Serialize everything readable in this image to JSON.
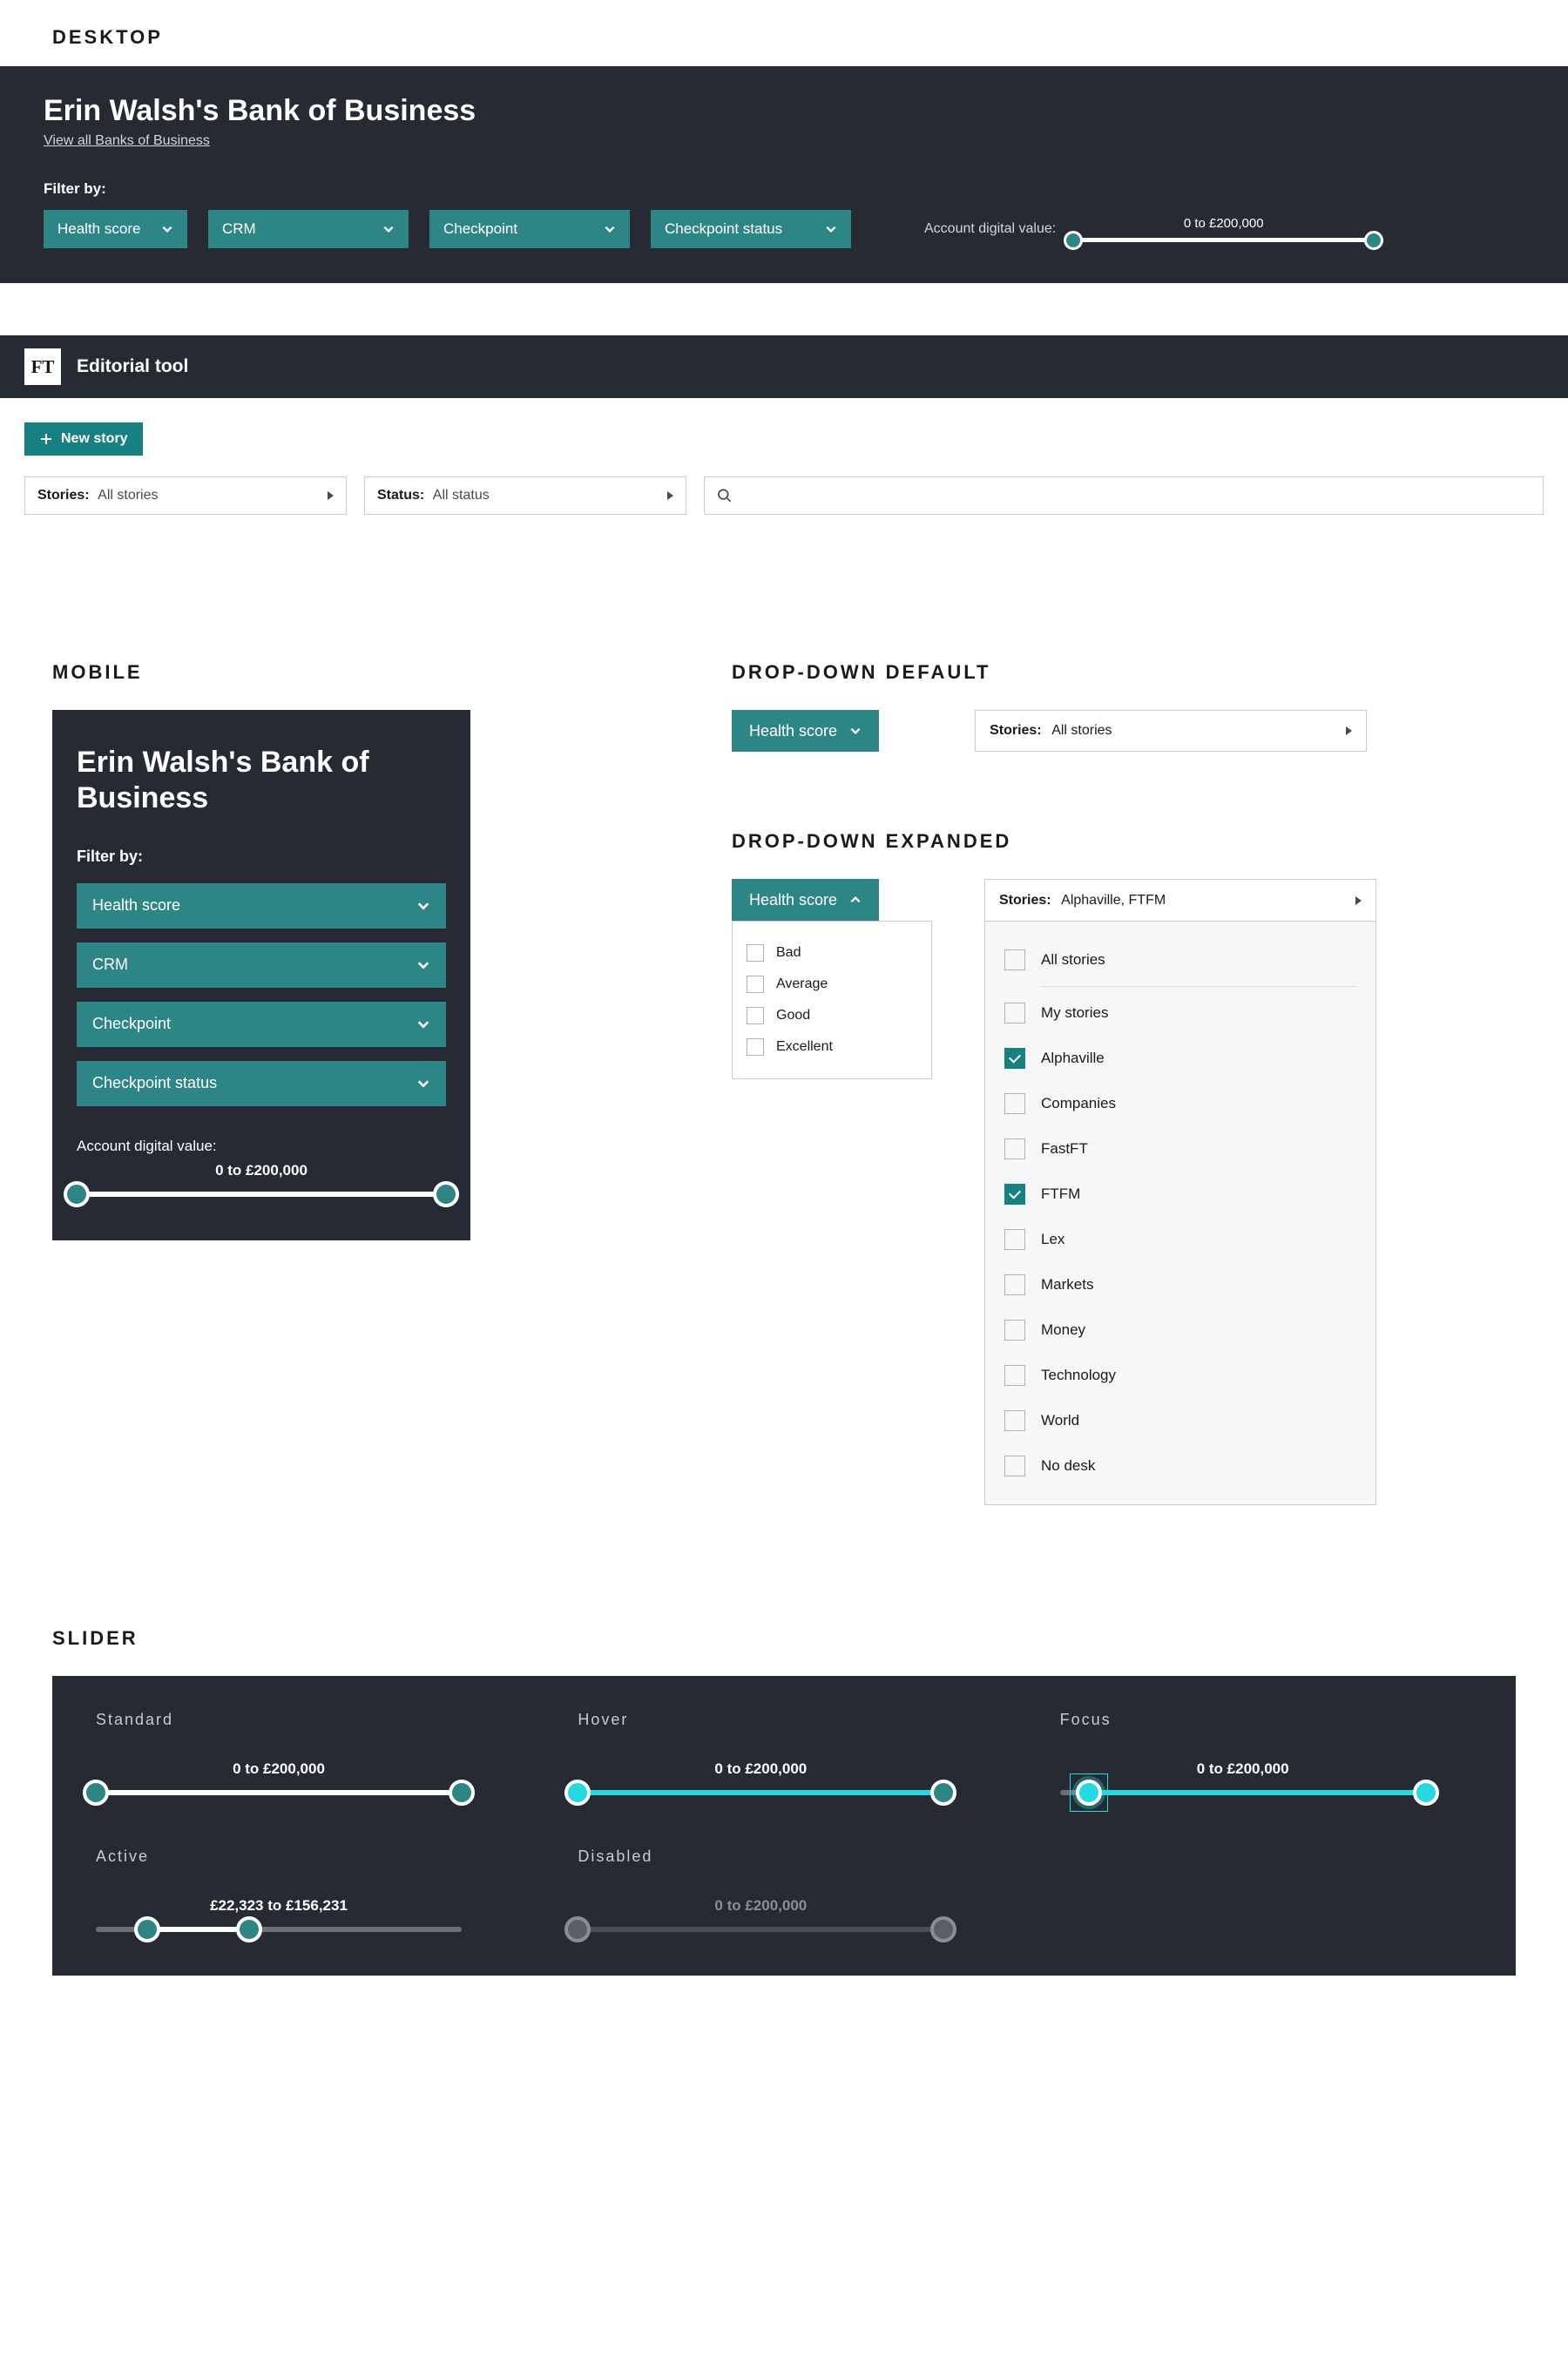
{
  "sections": {
    "desktop": "DESKTOP",
    "mobile": "MOBILE",
    "dd_default": "DROP-DOWN DEFAULT",
    "dd_expanded": "DROP-DOWN EXPANDED",
    "slider": "SLIDER"
  },
  "desktop": {
    "title": "Erin Walsh's Bank of Business",
    "view_all": "View all Banks of Business",
    "filter_by": "Filter by:",
    "filters": {
      "health_score": "Health score",
      "crm": "CRM",
      "checkpoint": "Checkpoint",
      "checkpoint_status": "Checkpoint status"
    },
    "adv_label": "Account digital value:",
    "adv_range": "0 to £200,000"
  },
  "editorial": {
    "logo": "FT",
    "title": "Editorial tool",
    "new_story": "New story",
    "stories_label": "Stories:",
    "stories_value": "All stories",
    "status_label": "Status:",
    "status_value": "All status",
    "search_placeholder": ""
  },
  "mobile": {
    "title": "Erin Walsh's Bank of Business",
    "filter_by": "Filter by:",
    "filters": {
      "health_score": "Health score",
      "crm": "CRM",
      "checkpoint": "Checkpoint",
      "checkpoint_status": "Checkpoint status"
    },
    "adv_label": "Account digital value:",
    "adv_range": "0 to £200,000"
  },
  "dd_default": {
    "pill": "Health score",
    "stories_label": "Stories:",
    "stories_value": "All stories"
  },
  "dd_expanded": {
    "pill": "Health score",
    "options": [
      "Bad",
      "Average",
      "Good",
      "Excellent"
    ],
    "stories_label": "Stories:",
    "stories_value": "Alphaville, FTFM",
    "story_options": [
      {
        "label": "All stories",
        "checked": false,
        "divider_after": true
      },
      {
        "label": "My stories",
        "checked": false
      },
      {
        "label": "Alphaville",
        "checked": true
      },
      {
        "label": "Companies",
        "checked": false
      },
      {
        "label": "FastFT",
        "checked": false
      },
      {
        "label": "FTFM",
        "checked": true
      },
      {
        "label": "Lex",
        "checked": false
      },
      {
        "label": "Markets",
        "checked": false
      },
      {
        "label": "Money",
        "checked": false
      },
      {
        "label": "Technology",
        "checked": false
      },
      {
        "label": "World",
        "checked": false
      },
      {
        "label": "No desk",
        "checked": false
      }
    ]
  },
  "slider_states": {
    "standard": {
      "label": "Standard",
      "range": "0 to £200,000",
      "fill": [
        0,
        100
      ],
      "handles": [
        0,
        100
      ]
    },
    "hover": {
      "label": "Hover",
      "range": "0 to £200,000",
      "fill": [
        0,
        100
      ],
      "handles": [
        0,
        100
      ]
    },
    "focus": {
      "label": "Focus",
      "range": "0 to £200,000",
      "fill": [
        8,
        100
      ],
      "handles": [
        8,
        100
      ]
    },
    "active": {
      "label": "Active",
      "range": "£22,323 to £156,231",
      "fill": [
        14,
        42
      ],
      "handles": [
        14,
        42
      ]
    },
    "disabled": {
      "label": "Disabled",
      "range": "0 to £200,000",
      "fill": [
        0,
        0
      ],
      "handles": [
        0,
        100
      ]
    }
  },
  "colors": {
    "bg_dark": "#262a33",
    "teal": "#2e8585",
    "teal_btn": "#178080",
    "cyan_hover": "#25d9e0"
  }
}
